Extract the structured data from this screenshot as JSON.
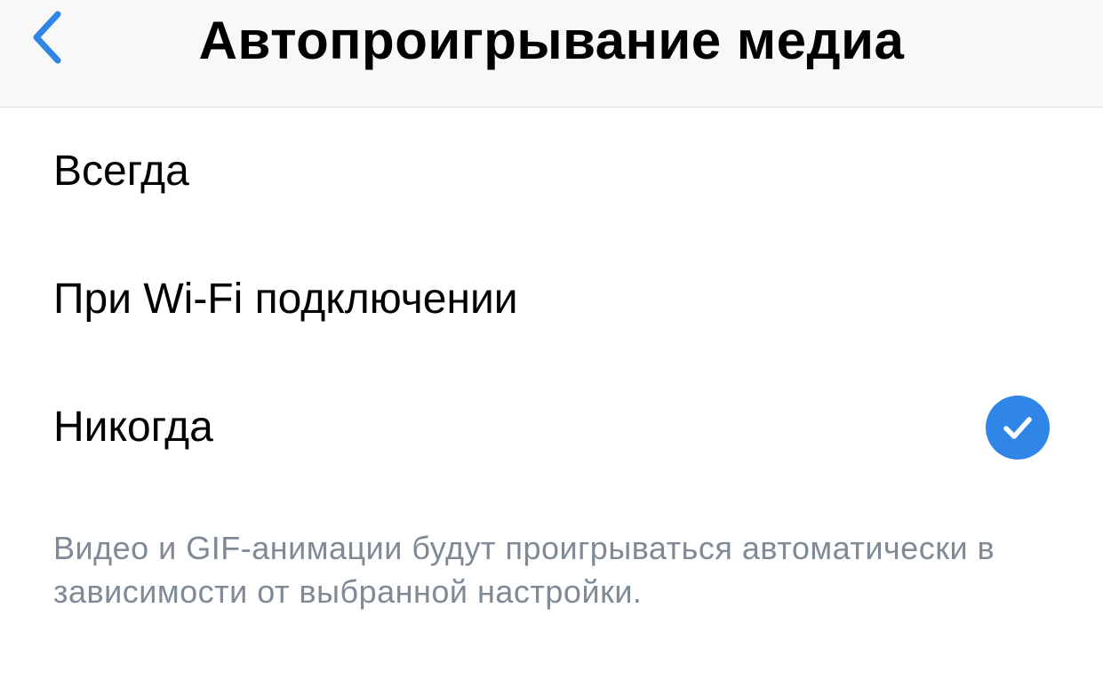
{
  "navbar": {
    "back_icon": "chevron-left-icon",
    "title": "Автопроигрывание медиа"
  },
  "options": [
    {
      "label": "Всегда",
      "selected": false
    },
    {
      "label": "При Wi-Fi подключении",
      "selected": false
    },
    {
      "label": "Никогда",
      "selected": true
    }
  ],
  "check_icon": "checkmark-icon",
  "footnote": "Видео и GIF-анимации будут проигрываться автоматически в зависимости от выбранной настройки.",
  "colors": {
    "accent": "#2f86e6",
    "footnote_text": "#7f8a96",
    "navbar_bg": "#f8f8f9"
  }
}
